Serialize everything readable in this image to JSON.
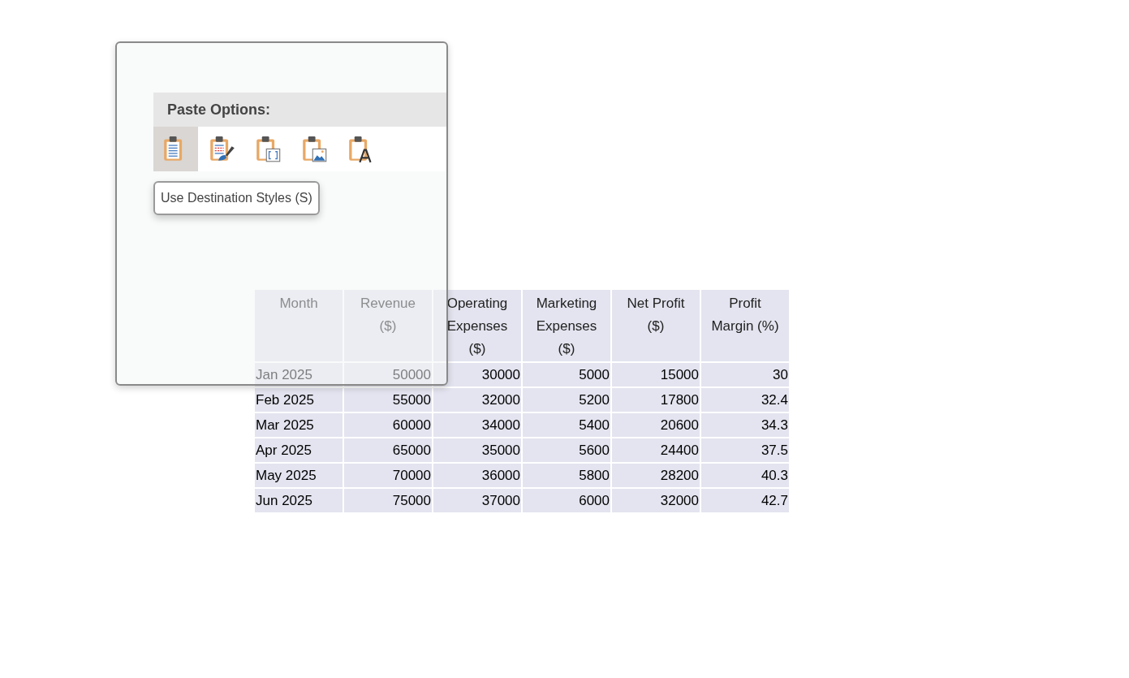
{
  "paste_menu": {
    "title": "Paste Options:",
    "options": [
      {
        "kind": "destination",
        "selected": true
      },
      {
        "kind": "keep-source",
        "selected": false
      },
      {
        "kind": "embed",
        "selected": false
      },
      {
        "kind": "picture",
        "selected": false
      },
      {
        "kind": "text-only",
        "selected": false
      }
    ],
    "tooltip": "Use Destination Styles (S)"
  },
  "table": {
    "columns": [
      "Month",
      "Revenue ($)",
      "Operating Expenses ($)",
      "Marketing Expenses ($)",
      "Net Profit ($)",
      "Profit Margin (%)"
    ],
    "rows": [
      [
        "Jan 2025",
        "50000",
        "30000",
        "5000",
        "15000",
        "30"
      ],
      [
        "Feb 2025",
        "55000",
        "32000",
        "5200",
        "17800",
        "32.4"
      ],
      [
        "Mar 2025",
        "60000",
        "34000",
        "5400",
        "20600",
        "34.3"
      ],
      [
        "Apr 2025",
        "65000",
        "35000",
        "5600",
        "24400",
        "37.5"
      ],
      [
        "May 2025",
        "70000",
        "36000",
        "5800",
        "28200",
        "40.3"
      ],
      [
        "Jun 2025",
        "75000",
        "37000",
        "6000",
        "32000",
        "42.7"
      ]
    ]
  }
}
